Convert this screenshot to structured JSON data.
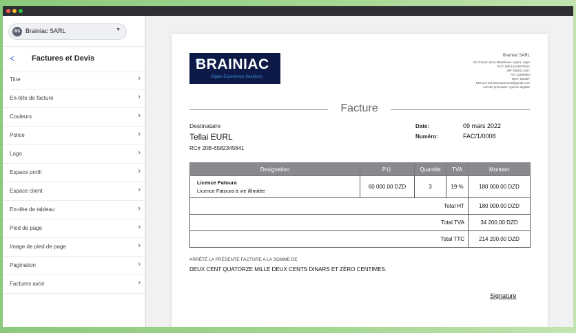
{
  "sidebar": {
    "company": {
      "avatar": "BS",
      "name": "Brainiac SARL"
    },
    "panel_title": "Factures et Devis",
    "items": [
      {
        "label": "Titre"
      },
      {
        "label": "En-tête de facture"
      },
      {
        "label": "Couleurs"
      },
      {
        "label": "Police"
      },
      {
        "label": "Logo"
      },
      {
        "label": "Espace profil"
      },
      {
        "label": "Espace client"
      },
      {
        "label": "En-tête de tableau"
      },
      {
        "label": "Pied de page"
      },
      {
        "label": "Image de pied de page"
      },
      {
        "label": "Pagination"
      },
      {
        "label": "Factures avoir"
      }
    ]
  },
  "invoice": {
    "logo": {
      "word": "BRAINIAC",
      "tagline": "Digital Experience Solutions"
    },
    "company_info": {
      "name": "Brainiac SARL",
      "lines": [
        "20 Chemin de la Madeleine- Hydra, Alger",
        "RC# 16B-12345678912",
        "tel# 0565213487",
        "AI# 12258964",
        "NIS# 156357",
        "EMAIL# benettaouaomass@gmail.com",
        "Activité principale: Agence digitale"
      ]
    },
    "title": "Facture",
    "recipient": {
      "label": "Destinataire",
      "name": "Tellai EURL",
      "rc": "RC# 20B-6582345641"
    },
    "meta": [
      {
        "label": "Date:",
        "value": "09 mars 2022"
      },
      {
        "label": "Numéro:",
        "value": "FAC/1/0008"
      }
    ],
    "table": {
      "headers": [
        "Designation",
        "P.U.",
        "Quantite",
        "TVA",
        "Montant"
      ],
      "row": {
        "designation_title": "Licence Fatoura",
        "designation_desc": "Licence Fatoura à vie illimitée",
        "pu": "60 000.00 DZD",
        "qty": "3",
        "tva": "19 %",
        "montant": "180 000.00 DZD"
      },
      "totals": [
        {
          "label": "Total HT",
          "value": "180 000.00 DZD"
        },
        {
          "label": "Total TVA",
          "value": "34 200.00 DZD"
        },
        {
          "label": "Total TTC",
          "value": "214 200.00 DZD"
        }
      ]
    },
    "amount_caption": "ARRÊTÉ LA PRÉSENTE FACTURE A LA SOMME DE",
    "amount_words": "DEUX CENT QUATORZE MILLE DEUX CENTS DINARS ET ZÉRO CENTIMES.",
    "signature": "Signature"
  }
}
